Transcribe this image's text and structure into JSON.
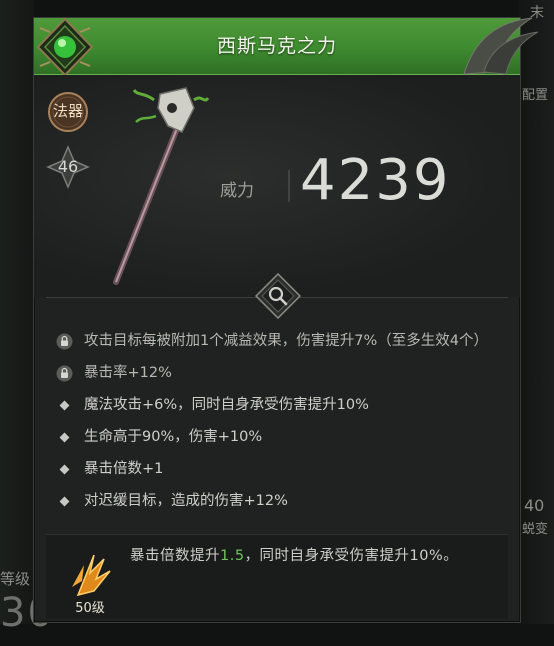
{
  "item": {
    "name": "西斯马克之力",
    "type_label": "法器",
    "level": "46",
    "power_label": "威力",
    "power_value": "4239"
  },
  "attributes": [
    {
      "text": "攻击目标每被附加1个减益效果，伤害提升7%（至多生效4个）",
      "locked": true
    },
    {
      "text": "暴击率+12%",
      "locked": true
    },
    {
      "text": "魔法攻击+6%，同时自身承受伤害提升10%",
      "locked": false
    },
    {
      "text": "生命高于90%，伤害+10%",
      "locked": false
    },
    {
      "text": "暴击倍数+1",
      "locked": false
    },
    {
      "text": "对迟缓目标，造成的伤害+12%",
      "locked": false
    }
  ],
  "skill": {
    "level_label": "50级",
    "text_before": "暴击倍数提升",
    "highlight": "1.5",
    "text_after": "，同时自身承受伤害提升10%。"
  },
  "background": {
    "right_top_text": "末",
    "right_mid_text": "配置",
    "right_low_text": "40",
    "right_low_text2": "蜕变",
    "left_text": "等级",
    "left_big": "30"
  },
  "colors": {
    "title_green": "#3e8a2f",
    "highlight_green": "#6fc25a",
    "panel_bg": "#202222"
  }
}
